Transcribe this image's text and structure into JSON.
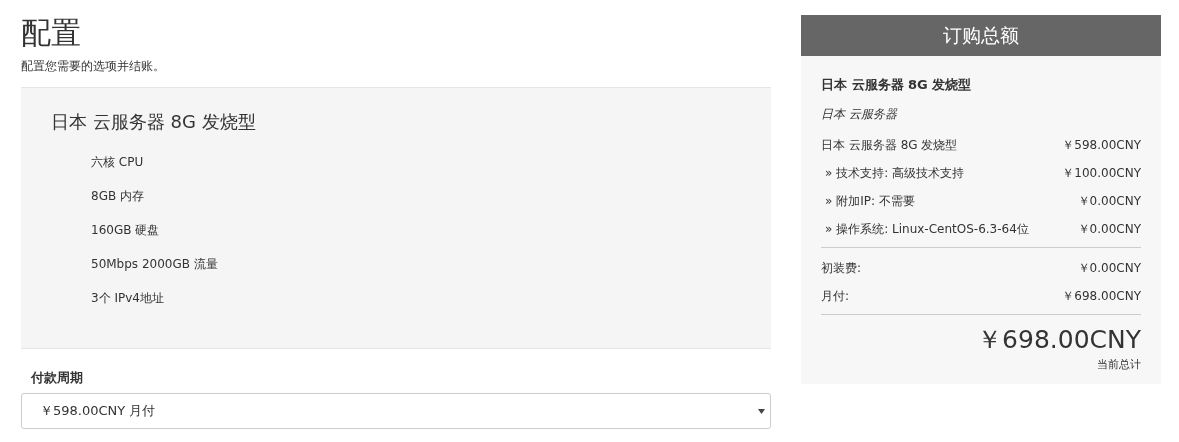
{
  "header": {
    "title": "配置",
    "subtitle": "配置您需要的选项并结账。"
  },
  "product": {
    "name": "日本 云服务器 8G 发烧型",
    "features": [
      "六核 CPU",
      "8GB 内存",
      "160GB 硬盘",
      "50Mbps 2000GB 流量",
      "3个 IPv4地址"
    ]
  },
  "billing_cycle": {
    "label": "付款周期",
    "value": "￥598.00CNY 月付"
  },
  "order_summary": {
    "title": "订购总额",
    "product_name": "日本 云服务器 8G 发烧型",
    "product_group": "日本 云服务器",
    "items": [
      {
        "kind": "main",
        "label": "日本 云服务器 8G 发烧型",
        "price": "￥598.00CNY"
      },
      {
        "kind": "option",
        "label": "» 技术支持: 高级技术支持",
        "price": "￥100.00CNY"
      },
      {
        "kind": "option",
        "label": "» 附加IP: 不需要",
        "price": "￥0.00CNY"
      },
      {
        "kind": "option",
        "label": "» 操作系统: Linux-CentOS-6.3-64位",
        "price": "￥0.00CNY"
      }
    ],
    "fees": [
      {
        "label": "初装费:",
        "price": "￥0.00CNY"
      },
      {
        "label": "月付:",
        "price": "￥698.00CNY"
      }
    ],
    "total": "￥698.00CNY",
    "total_label": "当前总计"
  }
}
